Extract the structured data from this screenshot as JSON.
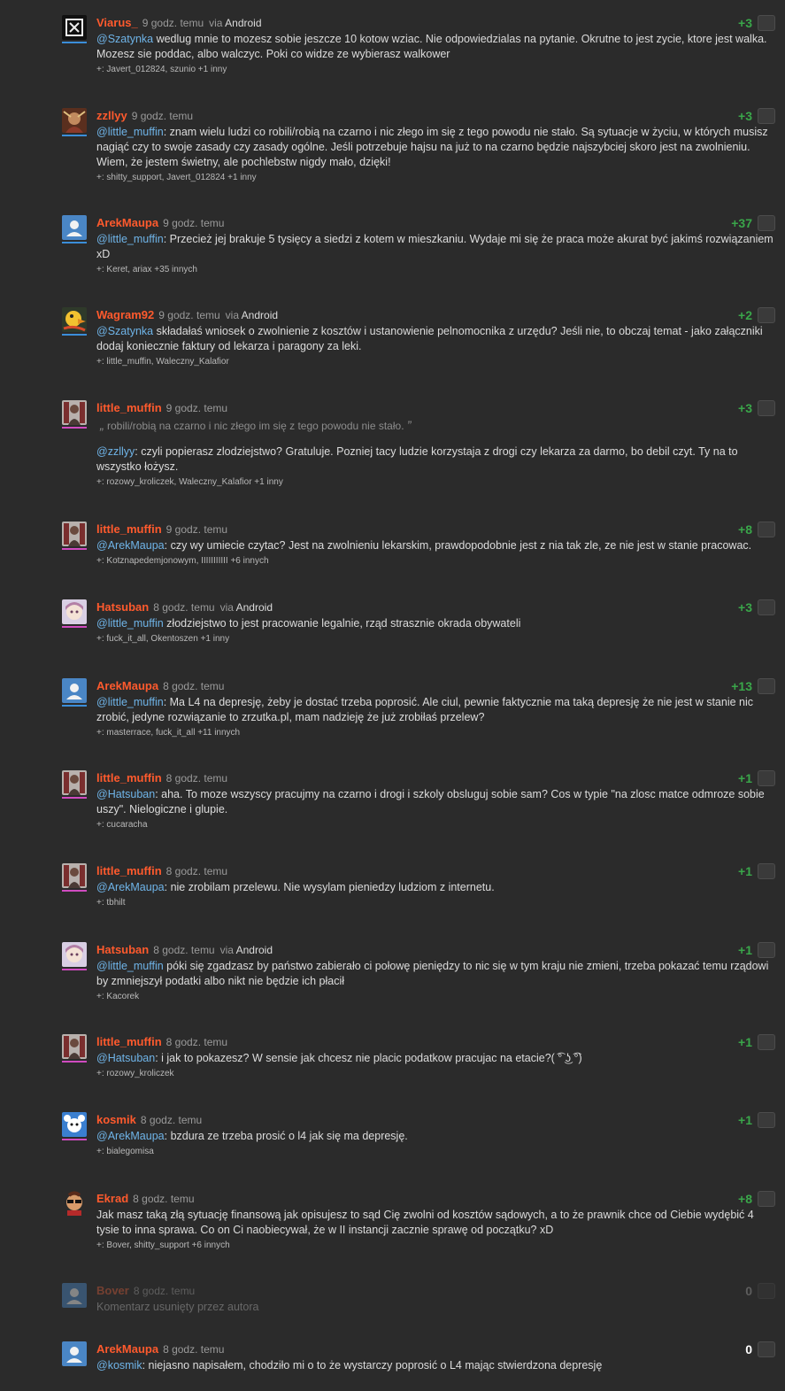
{
  "colors": {
    "background": "#2b2b2b",
    "author": "#ff5a2d",
    "score_positive": "#3aa64a",
    "mention": "#6fb4e8",
    "male_bar": "#3b8ed9",
    "female_bar": "#d04bc0"
  },
  "comments": [
    {
      "author": "Viarus_",
      "time": "9 godz. temu",
      "via": "via",
      "platform": "Android",
      "score": "+3",
      "gender": "m",
      "avatar_icon": "rammstein-logo-icon",
      "mention": "@Szatynka",
      "text": " wedlug mnie to mozesz sobie jeszcze 10 kotow wziac. Nie odpowiedzialas na pytanie. Okrutne to jest zycie, ktore jest walka. Mozesz sie poddac, albo walczyc. Poki co widze ze wybierasz walkower",
      "voters": "+: Javert_012824, szunio +1 inny"
    },
    {
      "author": "zzllyy",
      "time": "9 godz. temu",
      "score": "+3",
      "gender": "m",
      "avatar_icon": "artwork-avatar-icon",
      "mention": "@little_muffin",
      "text": ": znam wielu ludzi co robili/robią na czarno i nic złego im się z tego powodu nie stało. Są sytuacje w życiu, w których musisz nagiąć czy to swoje zasady czy zasady ogólne. Jeśli potrzebuje hajsu na już to na czarno będzie najszybciej skoro jest na zwolnieniu. Wiem, że jestem świetny, ale pochlebstw nigdy mało, dzięki!",
      "voters": "+: shitty_support, Javert_012824 +1 inny"
    },
    {
      "author": "ArekMaupa",
      "time": "9 godz. temu",
      "score": "+37",
      "gender": "m",
      "avatar_icon": "default-user-icon",
      "mention": "@little_muffin",
      "text": ": Przecież jej brakuje 5 tysięcy a siedzi z kotem w mieszkaniu. Wydaje mi się że praca może akurat być jakimś rozwiązaniem xD",
      "voters": "+: Keret, ariax +35 innych"
    },
    {
      "author": "Wagram92",
      "time": "9 godz. temu",
      "via": "via",
      "platform": "Android",
      "score": "+2",
      "gender": "m",
      "avatar_icon": "duck-avatar-icon",
      "mention": "@Szatynka",
      "text": " składałaś wniosek o zwolnienie z kosztów i ustanowienie pelnomocnika z urzędu? Jeśli nie, to obczaj temat - jako załączniki dodaj koniecznie faktury od lekarza i paragony za leki.",
      "voters": "+: little_muffin, Waleczny_Kalafior"
    },
    {
      "author": "little_muffin",
      "time": "9 godz. temu",
      "score": "+3",
      "gender": "f",
      "avatar_icon": "photo-avatar-icon",
      "quote_open": "„",
      "quote": "robili/robią na czarno i nic złego im się z tego powodu nie stało.",
      "quote_close": "”",
      "mention": "@zzllyy",
      "text": ": czyli popierasz zlodziejstwo? Gratuluje. Pozniej tacy ludzie korzystaja z drogi czy lekarza za darmo, bo debil czyt. Ty na to wszystko łożysz.",
      "voters": "+: rozowy_kroliczek, Waleczny_Kalafior +1 inny"
    },
    {
      "author": "little_muffin",
      "time": "9 godz. temu",
      "score": "+8",
      "gender": "f",
      "avatar_icon": "photo-avatar-icon",
      "mention": "@ArekMaupa",
      "text": ": czy wy umiecie czytac? Jest na zwolnieniu lekarskim, prawdopodobnie jest z nia tak zle, ze nie jest w stanie pracowac.",
      "voters": "+: Kotznapedemjonowym, IIIIIIIIIII +6 innych"
    },
    {
      "author": "Hatsuban",
      "time": "8 godz. temu",
      "via": "via",
      "platform": "Android",
      "score": "+3",
      "gender": "f",
      "avatar_icon": "anime-avatar-icon",
      "mention": "@little_muffin",
      "text": " złodziejstwo to jest pracowanie legalnie, rząd strasznie okrada obywateli",
      "voters": "+: fuck_it_all, Okentoszen +1 inny"
    },
    {
      "author": "ArekMaupa",
      "time": "8 godz. temu",
      "score": "+13",
      "gender": "m",
      "avatar_icon": "default-user-icon",
      "mention": "@little_muffin",
      "text": ": Ma L4 na depresję, żeby je dostać trzeba poprosić. Ale ciul, pewnie faktycznie ma taką depresję że nie jest w stanie nic zrobić, jedyne rozwiązanie to zrzutka.pl, mam nadzieję że już zrobiłaś przelew?",
      "voters": "+: masterrace, fuck_it_all +11 innych"
    },
    {
      "author": "little_muffin",
      "time": "8 godz. temu",
      "score": "+1",
      "gender": "f",
      "avatar_icon": "photo-avatar-icon",
      "mention": "@Hatsuban",
      "text": ": aha. To moze wszyscy pracujmy na czarno i drogi i szkoly obsluguj sobie sam? Cos w typie \"na zlosc matce odmroze sobie uszy\". Nielogiczne i glupie.",
      "voters": "+: cucaracha"
    },
    {
      "author": "little_muffin",
      "time": "8 godz. temu",
      "score": "+1",
      "gender": "f",
      "avatar_icon": "photo-avatar-icon",
      "mention": "@ArekMaupa",
      "text": ": nie zrobilam przelewu. Nie wysylam pieniedzy ludziom z internetu.",
      "voters": "+: tbhilt"
    },
    {
      "author": "Hatsuban",
      "time": "8 godz. temu",
      "via": "via",
      "platform": "Android",
      "score": "+1",
      "gender": "f",
      "avatar_icon": "anime-avatar-icon",
      "mention": "@little_muffin",
      "text": " póki się zgadzasz by państwo zabierało ci połowę pieniędzy to nic się w tym kraju nie zmieni, trzeba pokazać temu rządowi by zmniejszył podatki albo nikt nie będzie ich płacił",
      "voters": "+: Kacorek"
    },
    {
      "author": "little_muffin",
      "time": "8 godz. temu",
      "score": "+1",
      "gender": "f",
      "avatar_icon": "photo-avatar-icon",
      "mention": "@Hatsuban",
      "text": ": i jak to pokazesz? W sensie jak chcesz nie placic podatkow pracujac na etacie?( ͡° ͜ʖ ͡°)",
      "voters": "+: rozowy_kroliczek"
    },
    {
      "author": "kosmik",
      "time": "8 godz. temu",
      "score": "+1",
      "gender": "f",
      "avatar_icon": "cartoon-avatar-icon",
      "mention": "@ArekMaupa",
      "text": ": bzdura ze trzeba prosić o l4 jak się ma depresję.",
      "voters": "+: bialegomisa"
    },
    {
      "author": "Ekrad",
      "time": "8 godz. temu",
      "score": "+8",
      "gender": "none",
      "avatar_icon": "sunglasses-avatar-icon",
      "mention": "",
      "text": "Jak masz taką złą sytuację finansową jak opisujesz to sąd Cię zwolni od kosztów sądowych, a to że prawnik chce od Ciebie wydębić 4 tysie to inna sprawa. Co on Ci naobiecywał, że w II instancji zacznie sprawę od początku? xD",
      "voters": "+: Bover, shitty_support +6 innych"
    },
    {
      "author": "Bover",
      "time": "8 godz. temu",
      "score": "0",
      "gender": "none",
      "avatar_icon": "default-user-icon",
      "deleted": true,
      "mention": "",
      "text": "Komentarz usunięty przez autora",
      "voters": ""
    },
    {
      "author": "ArekMaupa",
      "time": "8 godz. temu",
      "score": "0",
      "gender": "none",
      "avatar_icon": "default-user-icon",
      "mention": "@kosmik",
      "text": ": niejasno napisałem, chodziło mi o to że wystarczy poprosić o L4 mając stwierdzona depresję",
      "voters": ""
    }
  ]
}
